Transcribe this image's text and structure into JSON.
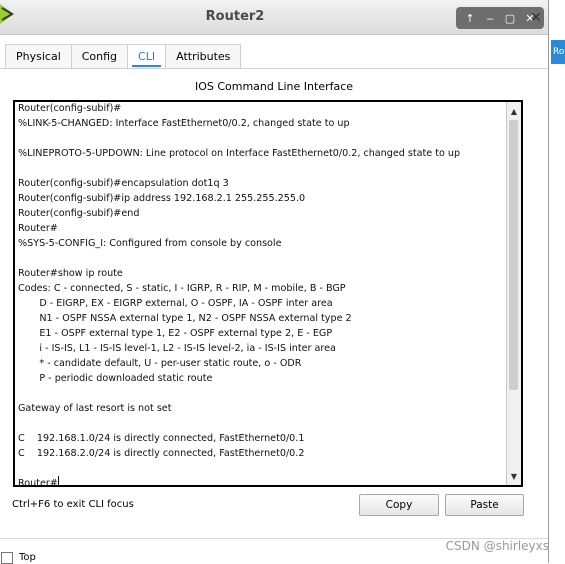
{
  "window": {
    "title": "Router2",
    "controls": [
      "↑",
      "‒",
      "▢",
      "✕"
    ],
    "close": "✕",
    "side_tab": "Ro"
  },
  "tabs": [
    {
      "label": "Physical",
      "active": false
    },
    {
      "label": "Config",
      "active": false
    },
    {
      "label": "CLI",
      "active": true
    },
    {
      "label": "Attributes",
      "active": false
    }
  ],
  "cli": {
    "heading": "IOS Command Line Interface",
    "output": "Router(config-subif)#\n%LINK-5-CHANGED: Interface FastEthernet0/0.2, changed state to up\n\n%LINEPROTO-5-UPDOWN: Line protocol on Interface FastEthernet0/0.2, changed state to up\n\nRouter(config-subif)#encapsulation dot1q 3\nRouter(config-subif)#ip address 192.168.2.1 255.255.255.0\nRouter(config-subif)#end\nRouter#\n%SYS-5-CONFIG_I: Configured from console by console\n\nRouter#show ip route\nCodes: C - connected, S - static, I - IGRP, R - RIP, M - mobile, B - BGP\n       D - EIGRP, EX - EIGRP external, O - OSPF, IA - OSPF inter area\n       N1 - OSPF NSSA external type 1, N2 - OSPF NSSA external type 2\n       E1 - OSPF external type 1, E2 - OSPF external type 2, E - EGP\n       i - IS-IS, L1 - IS-IS level-1, L2 - IS-IS level-2, ia - IS-IS inter area\n       * - candidate default, U - per-user static route, o - ODR\n       P - periodic downloaded static route\n\nGateway of last resort is not set\n\nC    192.168.1.0/24 is directly connected, FastEthernet0/0.1\nC    192.168.2.0/24 is directly connected, FastEthernet0/0.2\n\n",
    "prompt": "Router#"
  },
  "footer": {
    "hint": "Ctrl+F6 to exit CLI focus",
    "copy_label": "Copy",
    "paste_label": "Paste",
    "top_label": "Top",
    "top_checked": false
  },
  "watermark": "CSDN @shirleyxs",
  "colors": {
    "accent": "#2a8ad8",
    "titlebar_controls": "#6e6e6e"
  }
}
